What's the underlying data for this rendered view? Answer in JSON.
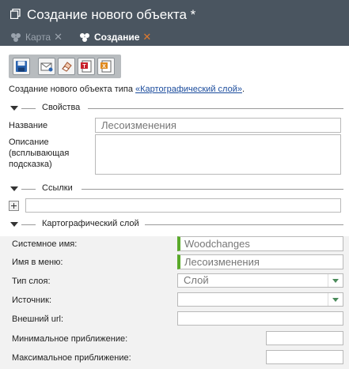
{
  "window": {
    "title": "Создание нового объекта *"
  },
  "tabs": [
    {
      "label": "Карта",
      "icon": "objects-icon",
      "active": false
    },
    {
      "label": "Создание",
      "icon": "objects-icon",
      "active": true
    }
  ],
  "toolbar": {
    "buttons": [
      {
        "name": "save-button",
        "icon": "floppy-disk-icon"
      },
      {
        "name": "send-button",
        "icon": "envelope-icon"
      },
      {
        "name": "clear-button",
        "icon": "eraser-icon"
      },
      {
        "name": "template-button",
        "icon": "red-document-icon"
      },
      {
        "name": "export-button",
        "icon": "orange-document-icon"
      }
    ]
  },
  "description": {
    "prefix": "Создание нового объекта типа ",
    "link": "«Картографический слой»",
    "suffix": "."
  },
  "properties": {
    "section_label": "Свойства",
    "name_label": "Название",
    "name_value": "Лесоизменения",
    "description_label_1": "Описание",
    "description_label_2": "(всплывающая",
    "description_label_3": "подсказка)",
    "description_value": ""
  },
  "links": {
    "section_label": "Ссылки",
    "value": ""
  },
  "layer": {
    "section_label": "Картографический слой",
    "system_name_label": "Системное имя:",
    "system_name_value": "Woodchanges",
    "menu_name_label": "Имя в меню:",
    "menu_name_value": "Лесоизменения",
    "layer_type_label": "Тип слоя:",
    "layer_type_value": "Слой",
    "source_label": "Источник:",
    "source_value": "",
    "external_url_label": "Внешний url:",
    "external_url_value": "",
    "min_zoom_label": "Минимальное приближение:",
    "min_zoom_value": "",
    "max_zoom_label": "Максимальное приближение:",
    "max_zoom_value": ""
  },
  "colors": {
    "header_bg": "#4a5560",
    "active_tab_close": "#e07a2e",
    "required_marker": "#5aaa2a",
    "link": "#1a4b9c"
  }
}
